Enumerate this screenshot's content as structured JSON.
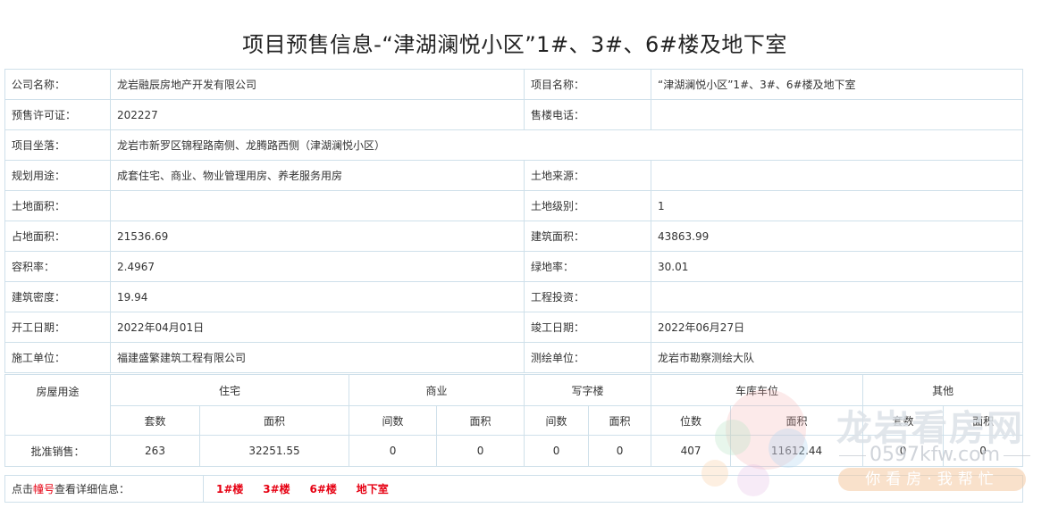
{
  "title": "项目预售信息-“津湖澜悦小区”1#、3#、6#楼及地下室",
  "info": {
    "rows": [
      {
        "l1": "公司名称：",
        "v1": "龙岩融辰房地产开发有限公司",
        "l2": "项目名称：",
        "v2": "“津湖澜悦小区”1#、3#、6#楼及地下室"
      },
      {
        "l1": "预售许可证：",
        "v1": "202227",
        "l2": "售楼电话：",
        "v2": ""
      },
      {
        "l1": "项目坐落：",
        "v1": "龙岩市新罗区锦程路南侧、龙腾路西侧（津湖澜悦小区）"
      },
      {
        "l1": "规划用途：",
        "v1": "成套住宅、商业、物业管理用房、养老服务用房",
        "l2": "土地来源：",
        "v2": ""
      },
      {
        "l1": "土地面积：",
        "v1": "",
        "l2": "土地级别：",
        "v2": "1"
      },
      {
        "l1": "占地面积：",
        "v1": "21536.69",
        "l2": "建筑面积：",
        "v2": "43863.99"
      },
      {
        "l1": "容积率：",
        "v1": "2.4967",
        "l2": "绿地率：",
        "v2": "30.01"
      },
      {
        "l1": "建筑密度：",
        "v1": "19.94",
        "l2": "工程投资：",
        "v2": ""
      },
      {
        "l1": "开工日期：",
        "v1": "2022年04月01日",
        "l2": "竣工日期：",
        "v2": "2022年06月27日"
      },
      {
        "l1": "施工单位：",
        "v1": "福建盛繁建筑工程有限公司",
        "l2": "测绘单位：",
        "v2": "龙岩市勘察测绘大队"
      }
    ]
  },
  "sales": {
    "usage_header": "房屋用途",
    "groups": [
      "住宅",
      "商业",
      "写字楼",
      "车库车位",
      "其他"
    ],
    "sub": {
      "count_residential": "套数",
      "area": "面积",
      "count_units": "间数",
      "count_spots": "位数"
    },
    "row_label": "批准销售：",
    "values": [
      "263",
      "32251.55",
      "0",
      "0",
      "0",
      "0",
      "407",
      "11612.44",
      "0",
      "0"
    ]
  },
  "footer": {
    "hint_prefix": "点击",
    "hint_red": "幢号",
    "hint_suffix": "查看详细信息：",
    "buildings": [
      "1#楼",
      "3#楼",
      "6#楼",
      "地下室"
    ]
  },
  "watermark": {
    "name": "龙岩看房网",
    "url": "0597kfw.com",
    "slogan": "你看房·我帮忙"
  }
}
